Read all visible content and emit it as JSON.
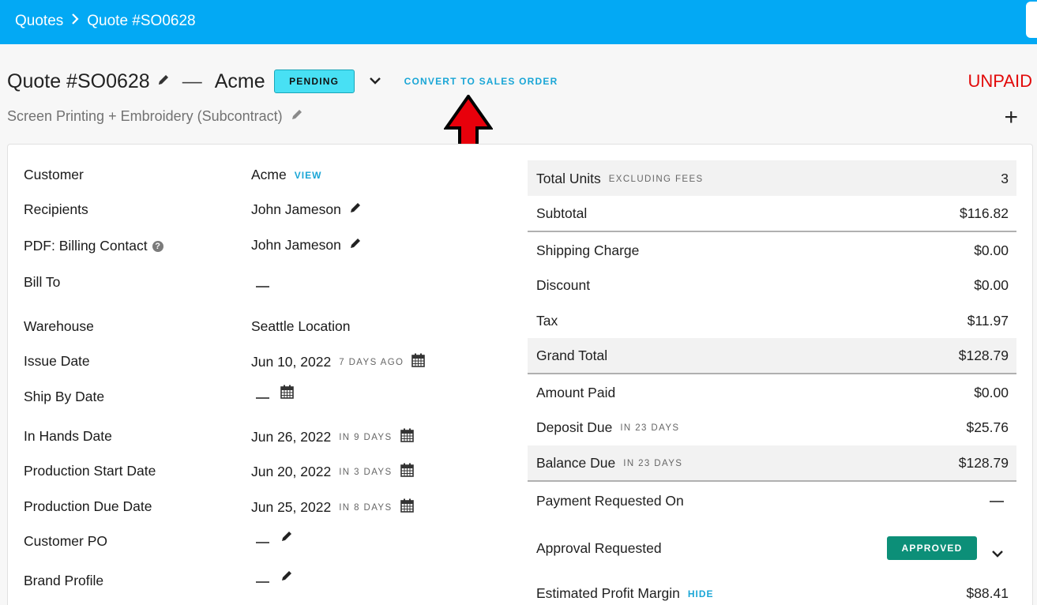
{
  "breadcrumb": {
    "root": "Quotes",
    "current": "Quote #SO0628"
  },
  "header": {
    "title": "Quote #SO0628",
    "customer": "Acme",
    "status": "PENDING",
    "convert_label": "CONVERT TO SALES ORDER",
    "payment_status": "UNPAID",
    "subtitle": "Screen Printing + Embroidery (Subcontract)"
  },
  "details": {
    "customer": {
      "label": "Customer",
      "value": "Acme",
      "link": "VIEW"
    },
    "recipients": {
      "label": "Recipients",
      "value": "John Jameson"
    },
    "billing_contact": {
      "label": "PDF: Billing Contact",
      "value": "John Jameson"
    },
    "bill_to": {
      "label": "Bill To"
    },
    "warehouse": {
      "label": "Warehouse",
      "value": "Seattle Location"
    },
    "issue_date": {
      "label": "Issue Date",
      "value": "Jun 10, 2022",
      "relative": "7 DAYS AGO"
    },
    "ship_by_date": {
      "label": "Ship By Date"
    },
    "in_hands_date": {
      "label": "In Hands Date",
      "value": "Jun 26, 2022",
      "relative": "IN 9 DAYS"
    },
    "production_start": {
      "label": "Production Start Date",
      "value": "Jun 20, 2022",
      "relative": "IN 3 DAYS"
    },
    "production_due": {
      "label": "Production Due Date",
      "value": "Jun 25, 2022",
      "relative": "IN 8 DAYS"
    },
    "customer_po": {
      "label": "Customer PO"
    },
    "brand_profile": {
      "label": "Brand Profile"
    }
  },
  "totals": {
    "total_units": {
      "label": "Total Units",
      "note": "EXCLUDING FEES",
      "value": "3"
    },
    "subtotal": {
      "label": "Subtotal",
      "value": "$116.82"
    },
    "shipping": {
      "label": "Shipping Charge",
      "value": "$0.00"
    },
    "discount": {
      "label": "Discount",
      "value": "$0.00"
    },
    "tax": {
      "label": "Tax",
      "value": "$11.97"
    },
    "grand_total": {
      "label": "Grand Total",
      "value": "$128.79"
    },
    "amount_paid": {
      "label": "Amount Paid",
      "value": "$0.00"
    },
    "deposit_due": {
      "label": "Deposit Due",
      "note": "IN 23 DAYS",
      "value": "$25.76"
    },
    "balance_due": {
      "label": "Balance Due",
      "note": "IN 23 DAYS",
      "value": "$128.79"
    },
    "payment_requested": {
      "label": "Payment Requested On"
    },
    "approval_requested": {
      "label": "Approval Requested",
      "status": "APPROVED"
    },
    "profit_margin": {
      "label": "Estimated Profit Margin",
      "link": "HIDE",
      "value": "$88.41"
    }
  },
  "colors": {
    "topbar": "#03a9f4",
    "accent": "#1aa6d6",
    "pending": "#48e0f4",
    "approved": "#0c8f78",
    "unpaid": "#e20a0a",
    "arrow": "#e8000b"
  },
  "icons": [
    "chevron-right-icon",
    "pencil-icon",
    "chevron-down-icon",
    "calendar-icon",
    "help-icon",
    "plus-icon",
    "red-up-arrow"
  ]
}
